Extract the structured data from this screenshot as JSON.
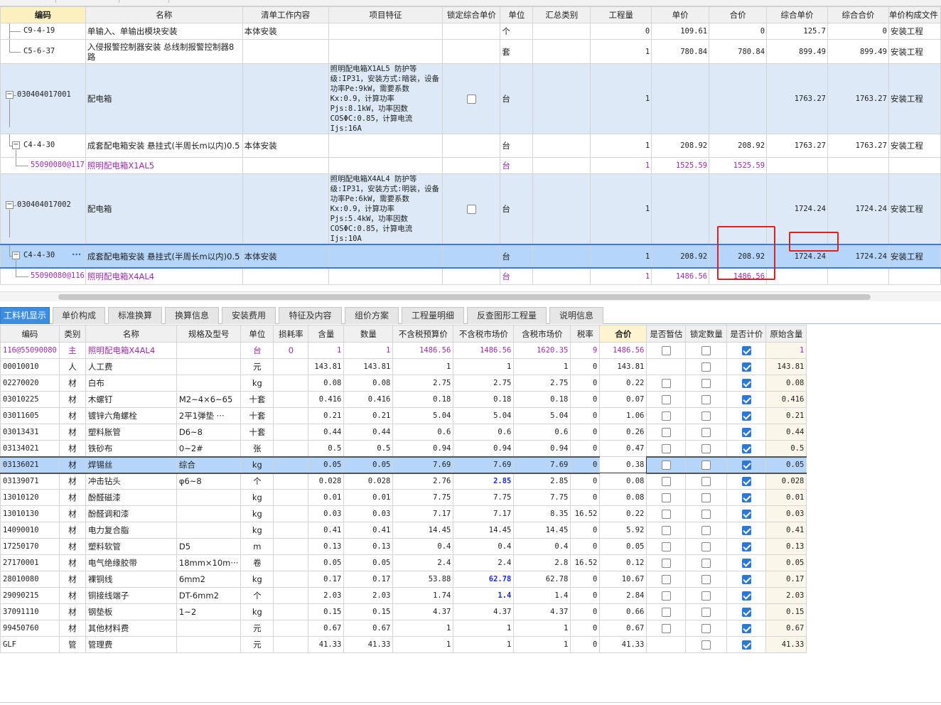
{
  "upper_headers": [
    "编码",
    "名称",
    "清单工作内容",
    "项目特征",
    "锁定综合单价",
    "单位",
    "汇总类别",
    "工程量",
    "单价",
    "合价",
    "综合单价",
    "综合合价",
    "单价构成文件"
  ],
  "upper_rows": [
    {
      "code": "C9-4-19",
      "name": "单输入、单输出模块安装",
      "content": "本体安装",
      "feature": "",
      "lock": "",
      "unit": "个",
      "qty": "0",
      "price": "109.61",
      "total": "0",
      "cprice": "125.7",
      "ctotal": "0",
      "file": "安装工程"
    },
    {
      "code": "C5-6-37",
      "name": "入侵报警控制器安装 总线制报警控制器8路",
      "content": "",
      "feature": "",
      "lock": "",
      "unit": "套",
      "qty": "1",
      "price": "780.84",
      "total": "780.84",
      "cprice": "899.49",
      "ctotal": "899.49",
      "file": "安装工程"
    },
    {
      "code": "030404017001",
      "name": "配电箱",
      "content": "",
      "feature": "照明配电箱X1AL5 防护等级:IP31，安装方式:暗装，设备功率Pe:9kW，需要系数Kx:0.9，计算功率Pjs:8.1kW，功率因数COSΦC:0.85，计算电流Ijs:16A",
      "lock": "box",
      "unit": "台",
      "qty": "1",
      "price": "",
      "total": "",
      "cprice": "1763.27",
      "ctotal": "1763.27",
      "file": "安装工程"
    },
    {
      "code": "C4-4-30",
      "name": "成套配电箱安装 悬挂式(半周长m以内)0.5",
      "content": "本体安装",
      "feature": "",
      "lock": "",
      "unit": "台",
      "qty": "1",
      "price": "208.92",
      "total": "208.92",
      "cprice": "1763.27",
      "ctotal": "1763.27",
      "file": "安装工程"
    },
    {
      "code": "55090080@117",
      "name": "照明配电箱X1AL5",
      "content": "",
      "feature": "",
      "lock": "",
      "unit": "台",
      "qty": "1",
      "price": "1525.59",
      "total": "1525.59",
      "cprice": "",
      "ctotal": "",
      "file": ""
    },
    {
      "code": "030404017002",
      "name": "配电箱",
      "content": "",
      "feature": "照明配电箱X4AL4 防护等级:IP31，安装方式:明装，设备功率Pe:6kW，需要系数Kx:0.9，计算功率Pjs:5.4kW，功率因数COSΦC:0.85，计算电流Ijs:10A",
      "lock": "box",
      "unit": "台",
      "qty": "1",
      "price": "",
      "total": "",
      "cprice": "1724.24",
      "ctotal": "1724.24",
      "file": "安装工程"
    },
    {
      "code": "C4-4-30",
      "name": "成套配电箱安装 悬挂式(半周长m以内)0.5",
      "content": "本体安装",
      "feature": "",
      "lock": "",
      "unit": "台",
      "qty": "1",
      "price": "208.92",
      "total": "208.92",
      "cprice": "1724.24",
      "ctotal": "1724.24",
      "file": "安装工程",
      "dots": "···"
    },
    {
      "code": "55090080@116",
      "name": "照明配电箱X4AL4",
      "content": "",
      "feature": "",
      "lock": "",
      "unit": "台",
      "qty": "1",
      "price": "1486.56",
      "total": "1486.56",
      "cprice": "",
      "ctotal": "",
      "file": ""
    }
  ],
  "tabs": [
    "工料机显示",
    "单价构成",
    "标准换算",
    "换算信息",
    "安装费用",
    "特征及内容",
    "组价方案",
    "工程量明细",
    "反查图形工程量",
    "说明信息"
  ],
  "lower_headers": [
    "编码",
    "类别",
    "名称",
    "规格及型号",
    "单位",
    "损耗率",
    "含量",
    "数量",
    "不含税预算价",
    "不含税市场价",
    "含税市场价",
    "税率",
    "合价",
    "是否暂估",
    "锁定数量",
    "是否计价",
    "原始含量"
  ],
  "lower_rows": [
    {
      "code": "55090080@116",
      "cat": "主",
      "name": "照明配电箱X4AL4",
      "spec": "",
      "unit": "台",
      "loss": "0",
      "content": "1",
      "qty": "1",
      "budget": "1486.56",
      "market": "1486.56",
      "taxmarket": "1620.35",
      "tax": "9",
      "total": "1486.56",
      "est": false,
      "lockq": false,
      "priced": true,
      "orig": "1"
    },
    {
      "code": "00010010",
      "cat": "人",
      "name": "人工费",
      "spec": "",
      "unit": "元",
      "loss": "",
      "content": "143.81",
      "qty": "143.81",
      "budget": "1",
      "market": "1",
      "taxmarket": "1",
      "tax": "0",
      "total": "143.81",
      "est": null,
      "lockq": false,
      "priced": true,
      "orig": "143.81"
    },
    {
      "code": "02270020",
      "cat": "材",
      "name": "白布",
      "spec": "",
      "unit": "kg",
      "loss": "",
      "content": "0.08",
      "qty": "0.08",
      "budget": "2.75",
      "market": "2.75",
      "taxmarket": "2.75",
      "tax": "0",
      "total": "0.22",
      "est": false,
      "lockq": false,
      "priced": true,
      "orig": "0.08"
    },
    {
      "code": "03010225",
      "cat": "材",
      "name": "木螺钉",
      "spec": "M2~4×6~65",
      "unit": "十套",
      "loss": "",
      "content": "0.416",
      "qty": "0.416",
      "budget": "0.18",
      "market": "0.18",
      "taxmarket": "0.18",
      "tax": "0",
      "total": "0.07",
      "est": false,
      "lockq": false,
      "priced": true,
      "orig": "0.416"
    },
    {
      "code": "03011605",
      "cat": "材",
      "name": "镀锌六角螺栓",
      "spec": "2平1弹垫 ···",
      "unit": "十套",
      "loss": "",
      "content": "0.21",
      "qty": "0.21",
      "budget": "5.04",
      "market": "5.04",
      "taxmarket": "5.04",
      "tax": "0",
      "total": "1.06",
      "est": false,
      "lockq": false,
      "priced": true,
      "orig": "0.21"
    },
    {
      "code": "03013431",
      "cat": "材",
      "name": "塑料胀管",
      "spec": "D6~8",
      "unit": "十套",
      "loss": "",
      "content": "0.44",
      "qty": "0.44",
      "budget": "0.6",
      "market": "0.6",
      "taxmarket": "0.6",
      "tax": "0",
      "total": "0.26",
      "est": false,
      "lockq": false,
      "priced": true,
      "orig": "0.44"
    },
    {
      "code": "03134021",
      "cat": "材",
      "name": "铁砂布",
      "spec": "0~2#",
      "unit": "张",
      "loss": "",
      "content": "0.5",
      "qty": "0.5",
      "budget": "0.94",
      "market": "0.94",
      "taxmarket": "0.94",
      "tax": "0",
      "total": "0.47",
      "est": false,
      "lockq": false,
      "priced": true,
      "orig": "0.5"
    },
    {
      "code": "03136021",
      "cat": "材",
      "name": "焊锡丝",
      "spec": "综合",
      "unit": "kg",
      "loss": "",
      "content": "0.05",
      "qty": "0.05",
      "budget": "7.69",
      "market": "7.69",
      "taxmarket": "7.69",
      "tax": "0",
      "total": "0.38",
      "est": false,
      "lockq": false,
      "priced": true,
      "orig": "0.05",
      "sel": true
    },
    {
      "code": "03139071",
      "cat": "材",
      "name": "冲击钻头",
      "spec": "φ6~8",
      "unit": "个",
      "loss": "",
      "content": "0.028",
      "qty": "0.028",
      "budget": "2.76",
      "market": "2.85",
      "taxmarket": "2.85",
      "tax": "0",
      "total": "0.08",
      "est": false,
      "lockq": false,
      "priced": true,
      "orig": "0.028",
      "hl": true
    },
    {
      "code": "13010120",
      "cat": "材",
      "name": "酚醛磁漆",
      "spec": "",
      "unit": "kg",
      "loss": "",
      "content": "0.01",
      "qty": "0.01",
      "budget": "7.75",
      "market": "7.75",
      "taxmarket": "7.75",
      "tax": "0",
      "total": "0.08",
      "est": false,
      "lockq": false,
      "priced": true,
      "orig": "0.01"
    },
    {
      "code": "13010130",
      "cat": "材",
      "name": "酚醛调和漆",
      "spec": "",
      "unit": "kg",
      "loss": "",
      "content": "0.03",
      "qty": "0.03",
      "budget": "7.17",
      "market": "7.17",
      "taxmarket": "8.35",
      "tax": "16.52",
      "total": "0.22",
      "est": false,
      "lockq": false,
      "priced": true,
      "orig": "0.03"
    },
    {
      "code": "14090010",
      "cat": "材",
      "name": "电力复合脂",
      "spec": "",
      "unit": "kg",
      "loss": "",
      "content": "0.41",
      "qty": "0.41",
      "budget": "14.45",
      "market": "14.45",
      "taxmarket": "14.45",
      "tax": "0",
      "total": "5.92",
      "est": false,
      "lockq": false,
      "priced": true,
      "orig": "0.41"
    },
    {
      "code": "17250170",
      "cat": "材",
      "name": "塑料软管",
      "spec": "D5",
      "unit": "m",
      "loss": "",
      "content": "0.13",
      "qty": "0.13",
      "budget": "0.4",
      "market": "0.4",
      "taxmarket": "0.4",
      "tax": "0",
      "total": "0.05",
      "est": false,
      "lockq": false,
      "priced": true,
      "orig": "0.13"
    },
    {
      "code": "27170001",
      "cat": "材",
      "name": "电气绝缘胶带",
      "spec": "18mm×10m···",
      "unit": "卷",
      "loss": "",
      "content": "0.05",
      "qty": "0.05",
      "budget": "2.4",
      "market": "2.4",
      "taxmarket": "2.8",
      "tax": "16.52",
      "total": "0.12",
      "est": false,
      "lockq": false,
      "priced": true,
      "orig": "0.05"
    },
    {
      "code": "28010080",
      "cat": "材",
      "name": "裸铜线",
      "spec": "6mm2",
      "unit": "kg",
      "loss": "",
      "content": "0.17",
      "qty": "0.17",
      "budget": "53.88",
      "market": "62.78",
      "taxmarket": "62.78",
      "tax": "0",
      "total": "10.67",
      "est": false,
      "lockq": false,
      "priced": true,
      "orig": "0.17",
      "hl": true
    },
    {
      "code": "29090215",
      "cat": "材",
      "name": "铜接线端子",
      "spec": "DT-6mm2",
      "unit": "个",
      "loss": "",
      "content": "2.03",
      "qty": "2.03",
      "budget": "1.74",
      "market": "1.4",
      "taxmarket": "1.4",
      "tax": "0",
      "total": "2.84",
      "est": false,
      "lockq": false,
      "priced": true,
      "orig": "2.03",
      "hl": true
    },
    {
      "code": "37091110",
      "cat": "材",
      "name": "钢垫板",
      "spec": "1~2",
      "unit": "kg",
      "loss": "",
      "content": "0.15",
      "qty": "0.15",
      "budget": "4.37",
      "market": "4.37",
      "taxmarket": "4.37",
      "tax": "0",
      "total": "0.66",
      "est": false,
      "lockq": false,
      "priced": true,
      "orig": "0.15"
    },
    {
      "code": "99450760",
      "cat": "材",
      "name": "其他材料费",
      "spec": "",
      "unit": "元",
      "loss": "",
      "content": "0.67",
      "qty": "0.67",
      "budget": "1",
      "market": "1",
      "taxmarket": "1",
      "tax": "0",
      "total": "0.67",
      "est": false,
      "lockq": false,
      "priced": true,
      "orig": "0.67"
    },
    {
      "code": "GLF",
      "cat": "管",
      "name": "管理费",
      "spec": "",
      "unit": "元",
      "loss": "",
      "content": "41.33",
      "qty": "41.33",
      "budget": "1",
      "market": "1",
      "taxmarket": "1",
      "tax": "0",
      "total": "41.33",
      "est": null,
      "lockq": false,
      "priced": true,
      "orig": "41.33"
    }
  ],
  "accent_color": "#3c8ce0",
  "highlight_color": "#e02020"
}
